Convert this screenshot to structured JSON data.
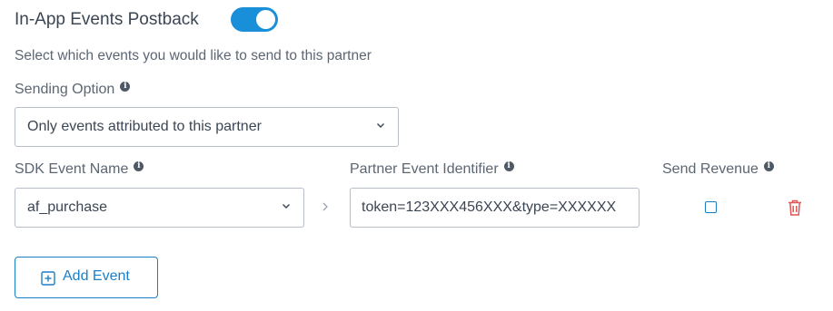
{
  "postback": {
    "title": "In-App Events Postback",
    "toggle_on": true,
    "subtitle": "Select which events you would like to send to this partner"
  },
  "sending_option": {
    "label": "Sending Option",
    "value": "Only events attributed to this partner"
  },
  "columns": {
    "sdk_event_name": "SDK Event Name",
    "partner_event_identifier": "Partner Event Identifier",
    "send_revenue": "Send Revenue"
  },
  "event_row": {
    "sdk_event": "af_purchase",
    "partner_identifier": "token=123XXX456XXX&type=XXXXXX",
    "send_revenue_checked": false
  },
  "add_event": {
    "label": "Add Event"
  },
  "icons": {
    "info": "info-icon",
    "chevron": "chevron-down-icon",
    "arrow": "chevron-right-icon",
    "trash": "trash-icon",
    "add": "plus-square-icon"
  },
  "colors": {
    "accent": "#1a8fd9",
    "danger": "#e05555",
    "text": "#3b4654"
  }
}
